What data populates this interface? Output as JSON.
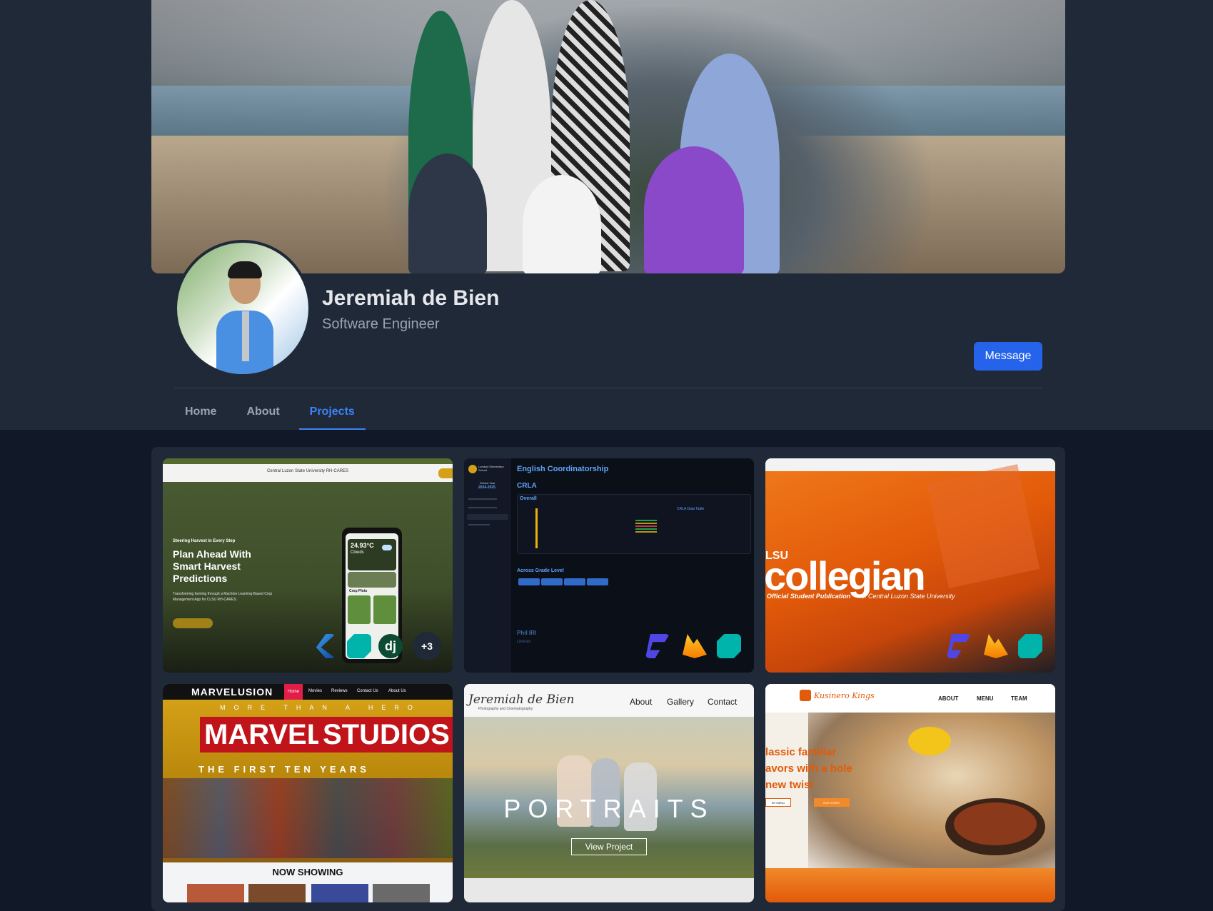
{
  "profile": {
    "name": "Jeremiah de Bien",
    "title": "Software Engineer",
    "message_label": "Message"
  },
  "tabs": [
    {
      "label": "Home",
      "active": false
    },
    {
      "label": "About",
      "active": false
    },
    {
      "label": "Projects",
      "active": true
    }
  ],
  "projects": [
    {
      "header_text": "Central Luzon State University RH-CARES",
      "eyebrow": "Steering Harvest in Every Step",
      "heading": "Plan Ahead With Smart Harvest Predictions",
      "body": "Transforming farming through a Machine Learning-Based Crop Management App for CLSU RH-CARES.",
      "phone_temp": "24.93°C",
      "phone_weather": "Clouds",
      "phone_section": "Crop Plots",
      "tech_icons": [
        "flutter-icon",
        "dart-icon",
        "django-icon"
      ],
      "more_count": "+3"
    },
    {
      "school": "Lomboy Elementary School",
      "school_year_label": "School Year",
      "school_year": "2024-2025",
      "title": "English Coordinatorship",
      "section": "CRLA",
      "chart_title": "Overall",
      "table_title": "CRLA Data Table",
      "grade_title": "Across Grade Level",
      "phil_iri": "Phil IRI",
      "phil_iri_overall": "Overall",
      "tech_icons": [
        "framer-icon",
        "firebase-icon",
        "dart-icon"
      ]
    },
    {
      "brand_prefix": "LSU",
      "brand": "collegian",
      "tagline_left": "Official Student Publication",
      "tagline_right": "of Central Luzon State University",
      "tech_icons": [
        "framer-icon",
        "firebase-icon",
        "dart-icon"
      ]
    },
    {
      "brand": "MARVELUSION",
      "nav": [
        "Home",
        "Movies",
        "Reviews",
        "Contact Us",
        "About Us"
      ],
      "tagline": "MORE THAN A HERO",
      "marvel": "MARVEL",
      "studios": "STUDIOS",
      "sub": "THE FIRST TEN YEARS",
      "section": "NOW SHOWING"
    },
    {
      "brand": "Jeremiah de Bien",
      "brand_sub": "Photography and Cinematography",
      "nav": [
        "About",
        "Gallery",
        "Contact"
      ],
      "hero": "PORTRAITS",
      "cta": "View Project"
    },
    {
      "brand": "Kusinero Kings",
      "nav": [
        "ABOUT",
        "MENU",
        "TEAM"
      ],
      "hero": "lassic familiar avors with a hole new twist",
      "cta_left": "ER MENU",
      "cta_right": "OUR STORY"
    }
  ],
  "colors": {
    "page_bg": "#111827",
    "panel_bg": "#1f2937",
    "accent": "#2563eb",
    "tab_active": "#3b82f6"
  }
}
